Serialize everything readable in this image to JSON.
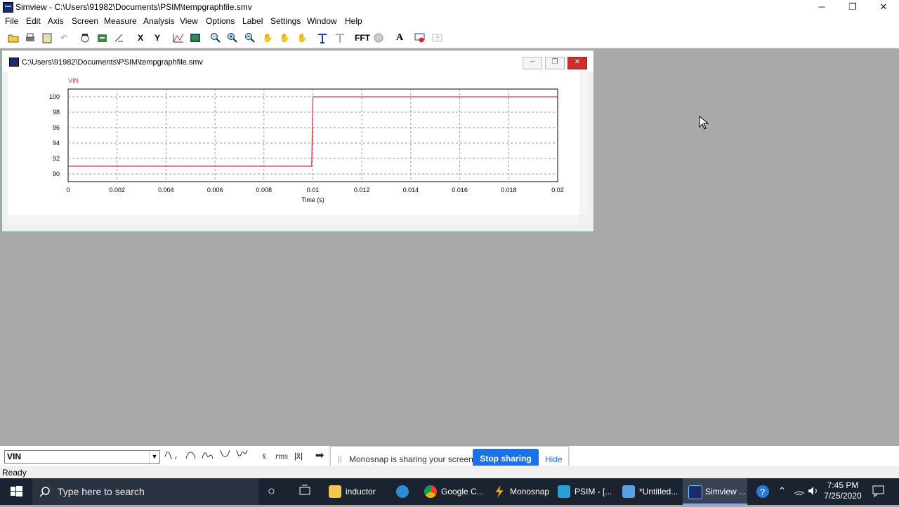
{
  "window": {
    "title": "Simview - C:\\Users\\91982\\Documents\\PSIM\\tempgraphfile.smv",
    "controls": {
      "minimize": "─",
      "restore": "❐",
      "close": "✕"
    }
  },
  "menu": [
    "File",
    "Edit",
    "Axis",
    "Screen",
    "Measure",
    "Analysis",
    "View",
    "Options",
    "Label",
    "Settings",
    "Window",
    "Help"
  ],
  "toolbar": {
    "x_label": "X",
    "y_label": "Y",
    "fft_label": "FFT",
    "text_label": "A"
  },
  "graph_window": {
    "title": "C:\\Users\\91982\\Documents\\PSIM\\tempgraphfile.smv",
    "controls": {
      "minimize": "─",
      "restore": "❐",
      "close": "✕"
    }
  },
  "chart_data": {
    "type": "line",
    "title": "",
    "xlabel": "Time (s)",
    "ylabel": "",
    "xlim": [
      0,
      0.02
    ],
    "ylim": [
      89,
      101
    ],
    "x_ticks": [
      "0",
      "0.002",
      "0.004",
      "0.006",
      "0.008",
      "0.01",
      "0.012",
      "0.014",
      "0.016",
      "0.018",
      "0.02"
    ],
    "y_ticks": [
      "90",
      "92",
      "94",
      "96",
      "98",
      "100"
    ],
    "grid": true,
    "series": [
      {
        "name": "VIN",
        "color": "#d9323f",
        "x": [
          0,
          0.00995,
          0.01,
          0.02
        ],
        "y": [
          91,
          91,
          100,
          100
        ]
      }
    ]
  },
  "bottom": {
    "variable": "VIN",
    "rms_label": "rms",
    "arrow": "➡"
  },
  "share_banner": {
    "message": "Monosnap is sharing your screen.",
    "stop_label": "Stop sharing",
    "hide_label": "Hide"
  },
  "status": "Ready",
  "taskbar": {
    "search_placeholder": "Type here to search",
    "apps": [
      {
        "label": "inductor",
        "color": "#f2c94c"
      },
      {
        "label": "",
        "color": "#2e8bd7"
      },
      {
        "label": "Google C...",
        "color": "#e94235"
      },
      {
        "label": "Monosnap",
        "color": "#f0b400"
      },
      {
        "label": "PSIM - [...",
        "color": "#2aa0d8"
      },
      {
        "label": "*Untitled...",
        "color": "#5aa0e0"
      },
      {
        "label": "Simview ...",
        "color": "#1a2a6a"
      }
    ],
    "time": "7:45 PM",
    "date": "7/25/2020"
  }
}
